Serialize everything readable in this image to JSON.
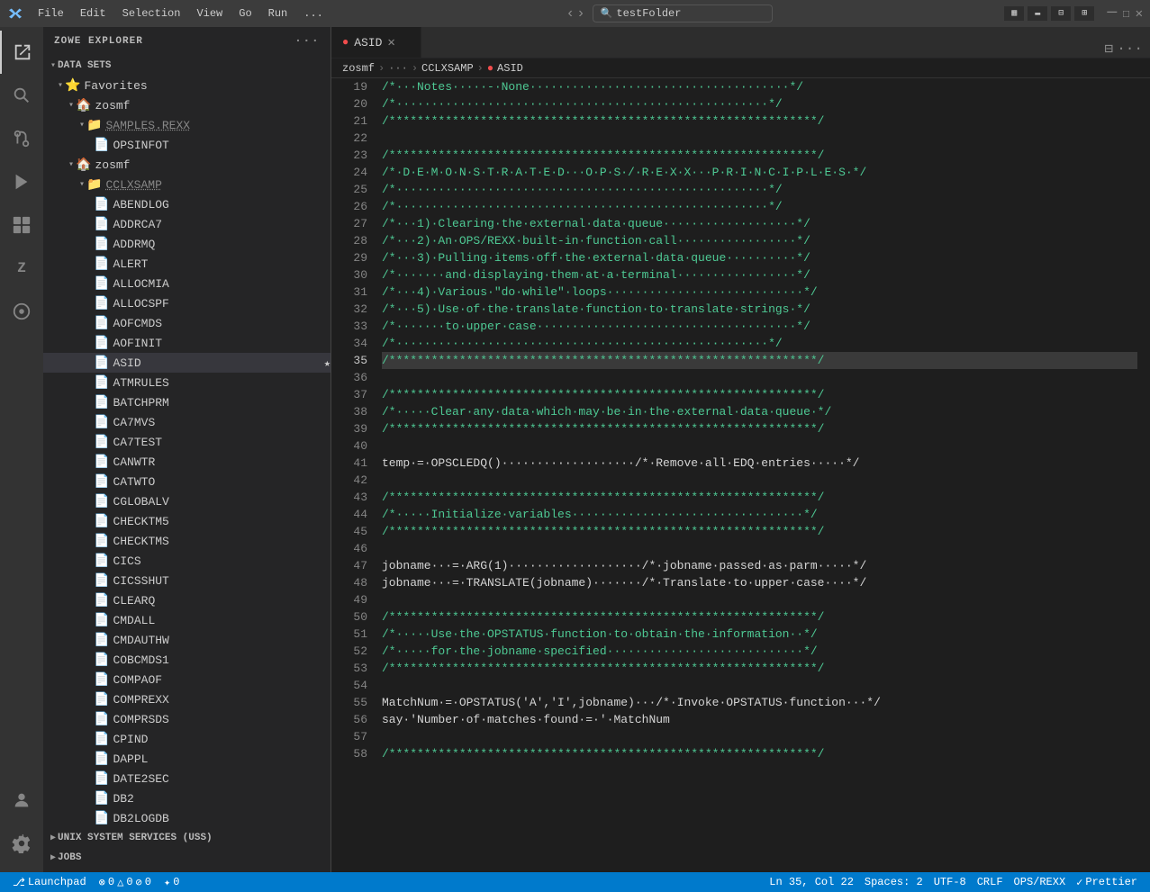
{
  "titleBar": {
    "menuItems": [
      "File",
      "Edit",
      "Selection",
      "View",
      "Go",
      "Run",
      "..."
    ],
    "search": "testFolder",
    "windowControls": [
      "minimize",
      "maximize",
      "restore",
      "close"
    ]
  },
  "activityBar": {
    "icons": [
      {
        "name": "explorer",
        "symbol": "⎗",
        "active": true
      },
      {
        "name": "search",
        "symbol": "🔍"
      },
      {
        "name": "source-control",
        "symbol": "⎇"
      },
      {
        "name": "run",
        "symbol": "▶"
      },
      {
        "name": "extensions",
        "symbol": "⊞"
      },
      {
        "name": "zowe",
        "symbol": "Z"
      },
      {
        "name": "remote",
        "symbol": "⌚"
      }
    ],
    "bottomIcons": [
      {
        "name": "account",
        "symbol": "👤"
      },
      {
        "name": "settings",
        "symbol": "⚙"
      }
    ]
  },
  "sidebar": {
    "title": "ZOWE EXPLORER",
    "sections": {
      "dataSets": {
        "label": "DATA SETS",
        "items": [
          {
            "label": "Favorites",
            "type": "folder",
            "indent": 16,
            "expanded": true
          },
          {
            "label": "zosmf",
            "type": "folder",
            "indent": 28,
            "expanded": true
          },
          {
            "label": "SAMPLES.REXX",
            "type": "folder",
            "indent": 40,
            "expanded": true,
            "blurred": true
          },
          {
            "label": "OPSINFOT",
            "type": "file",
            "indent": 56
          },
          {
            "label": "zosmf",
            "type": "folder",
            "indent": 28,
            "expanded": true
          },
          {
            "label": "CCLXSAMP",
            "type": "folder",
            "indent": 40,
            "expanded": true,
            "blurred": true
          },
          {
            "label": "ABENDLOG",
            "type": "file",
            "indent": 56
          },
          {
            "label": "ADDRCA7",
            "type": "file",
            "indent": 56
          },
          {
            "label": "ADDRMQ",
            "type": "file",
            "indent": 56
          },
          {
            "label": "ALERT",
            "type": "file",
            "indent": 56
          },
          {
            "label": "ALLOCMIA",
            "type": "file",
            "indent": 56
          },
          {
            "label": "ALLOCSPF",
            "type": "file",
            "indent": 56
          },
          {
            "label": "AOFCMDS",
            "type": "file",
            "indent": 56
          },
          {
            "label": "AOFINIT",
            "type": "file",
            "indent": 56
          },
          {
            "label": "ASID",
            "type": "file",
            "indent": 56,
            "selected": true,
            "starred": true
          },
          {
            "label": "ATMRULES",
            "type": "file",
            "indent": 56
          },
          {
            "label": "BATCHPRM",
            "type": "file",
            "indent": 56
          },
          {
            "label": "CA7MVS",
            "type": "file",
            "indent": 56
          },
          {
            "label": "CA7TEST",
            "type": "file",
            "indent": 56
          },
          {
            "label": "CANWTR",
            "type": "file",
            "indent": 56
          },
          {
            "label": "CATWTO",
            "type": "file",
            "indent": 56
          },
          {
            "label": "CGLOBALV",
            "type": "file",
            "indent": 56
          },
          {
            "label": "CHECKTM5",
            "type": "file",
            "indent": 56
          },
          {
            "label": "CHECKTMS",
            "type": "file",
            "indent": 56
          },
          {
            "label": "CICS",
            "type": "file",
            "indent": 56
          },
          {
            "label": "CICSSHUT",
            "type": "file",
            "indent": 56
          },
          {
            "label": "CLEARQ",
            "type": "file",
            "indent": 56
          },
          {
            "label": "CMDALL",
            "type": "file",
            "indent": 56
          },
          {
            "label": "CMDAUTHW",
            "type": "file",
            "indent": 56
          },
          {
            "label": "COBCMDS1",
            "type": "file",
            "indent": 56
          },
          {
            "label": "COMPAOF",
            "type": "file",
            "indent": 56
          },
          {
            "label": "COMPREXX",
            "type": "file",
            "indent": 56
          },
          {
            "label": "COMPRSDS",
            "type": "file",
            "indent": 56
          },
          {
            "label": "CPIND",
            "type": "file",
            "indent": 56
          },
          {
            "label": "DAPPL",
            "type": "file",
            "indent": 56
          },
          {
            "label": "DATE2SEC",
            "type": "file",
            "indent": 56
          },
          {
            "label": "DB2",
            "type": "file",
            "indent": 56
          },
          {
            "label": "DB2LOGDB",
            "type": "file",
            "indent": 56
          }
        ]
      },
      "unixSystems": {
        "label": "UNIX SYSTEM SERVICES (USS)"
      },
      "jobs": {
        "label": "JOBS"
      }
    }
  },
  "editor": {
    "tab": {
      "name": "ASID",
      "icon": "red-circle"
    },
    "breadcrumb": [
      "zosmf",
      "···",
      "CCLXSAMP",
      "ASID"
    ],
    "lines": [
      {
        "num": 19,
        "text": "/*···Notes·····-·None·····································*/"
      },
      {
        "num": 20,
        "text": "/*·····················································*/"
      },
      {
        "num": 21,
        "text": "/*************************************************************/"
      },
      {
        "num": 22,
        "text": ""
      },
      {
        "num": 23,
        "text": "/*************************************************************/"
      },
      {
        "num": 24,
        "text": "/*·D·E·M·O·N·S·T·R·A·T·E·D···O·P·S·/·R·E·X·X···P·R·I·N·C·I·P·L·E·S·*/"
      },
      {
        "num": 25,
        "text": "/*·····················································*/"
      },
      {
        "num": 26,
        "text": "/*·····················································*/"
      },
      {
        "num": 27,
        "text": "/*···1)·Clearing·the·external·data·queue···················*/"
      },
      {
        "num": 28,
        "text": "/*···2)·An·OPS/REXX·built-in·function·call·················*/"
      },
      {
        "num": 29,
        "text": "/*···3)·Pulling·items·off·the·external·data·queue··········*/"
      },
      {
        "num": 30,
        "text": "/*·······and·displaying·them·at·a·terminal·················*/"
      },
      {
        "num": 31,
        "text": "/*···4)·Various·\"do·while\"·loops····························*/"
      },
      {
        "num": 32,
        "text": "/*···5)·Use·of·the·translate·function·to·translate·strings·*/"
      },
      {
        "num": 33,
        "text": "/*·······to·upper·case·····································*/"
      },
      {
        "num": 34,
        "text": "/*·····················································*/"
      },
      {
        "num": 35,
        "text": "/*************************************************************/",
        "highlighted": true
      },
      {
        "num": 36,
        "text": ""
      },
      {
        "num": 37,
        "text": "/*************************************************************/"
      },
      {
        "num": 38,
        "text": "/*·····Clear·any·data·which·may·be·in·the·external·data·queue·*/"
      },
      {
        "num": 39,
        "text": "/*************************************************************/"
      },
      {
        "num": 40,
        "text": ""
      },
      {
        "num": 41,
        "text": "temp·=·OPSCLEDQ()···················/*·Remove·all·EDQ·entries·····*/"
      },
      {
        "num": 42,
        "text": ""
      },
      {
        "num": 43,
        "text": "/*************************************************************/"
      },
      {
        "num": 44,
        "text": "/*·····Initialize·variables·································*/"
      },
      {
        "num": 45,
        "text": "/*************************************************************/"
      },
      {
        "num": 46,
        "text": ""
      },
      {
        "num": 47,
        "text": "jobname···=·ARG(1)···················/*·jobname·passed·as·parm·····*/"
      },
      {
        "num": 48,
        "text": "jobname···=·TRANSLATE(jobname)·······/*·Translate·to·upper·case····*/"
      },
      {
        "num": 49,
        "text": ""
      },
      {
        "num": 50,
        "text": "/*************************************************************/"
      },
      {
        "num": 51,
        "text": "/*·····Use·the·OPSTATUS·function·to·obtain·the·information··*/"
      },
      {
        "num": 52,
        "text": "/*·····for·the·jobname·specified····························*/"
      },
      {
        "num": 53,
        "text": "/*************************************************************/"
      },
      {
        "num": 54,
        "text": ""
      },
      {
        "num": 55,
        "text": "MatchNum·=·OPSTATUS('A','I',jobname)···/*·Invoke·OPSTATUS·function···*/"
      },
      {
        "num": 56,
        "text": "say·'Number·of·matches·found·=·'·MatchNum"
      },
      {
        "num": 57,
        "text": ""
      },
      {
        "num": 58,
        "text": "/*************************************************************/"
      }
    ]
  },
  "statusBar": {
    "left": [
      {
        "label": "⎇ Launchpad"
      },
      {
        "label": "⊗ 0  △ 0  ⊘ 0"
      },
      {
        "label": "✦ 0"
      }
    ],
    "right": [
      {
        "label": "Ln 35, Col 22"
      },
      {
        "label": "Spaces: 2"
      },
      {
        "label": "UTF-8"
      },
      {
        "label": "CRLF"
      },
      {
        "label": "OPS/REXX"
      },
      {
        "label": "✓ Prettier"
      }
    ]
  }
}
